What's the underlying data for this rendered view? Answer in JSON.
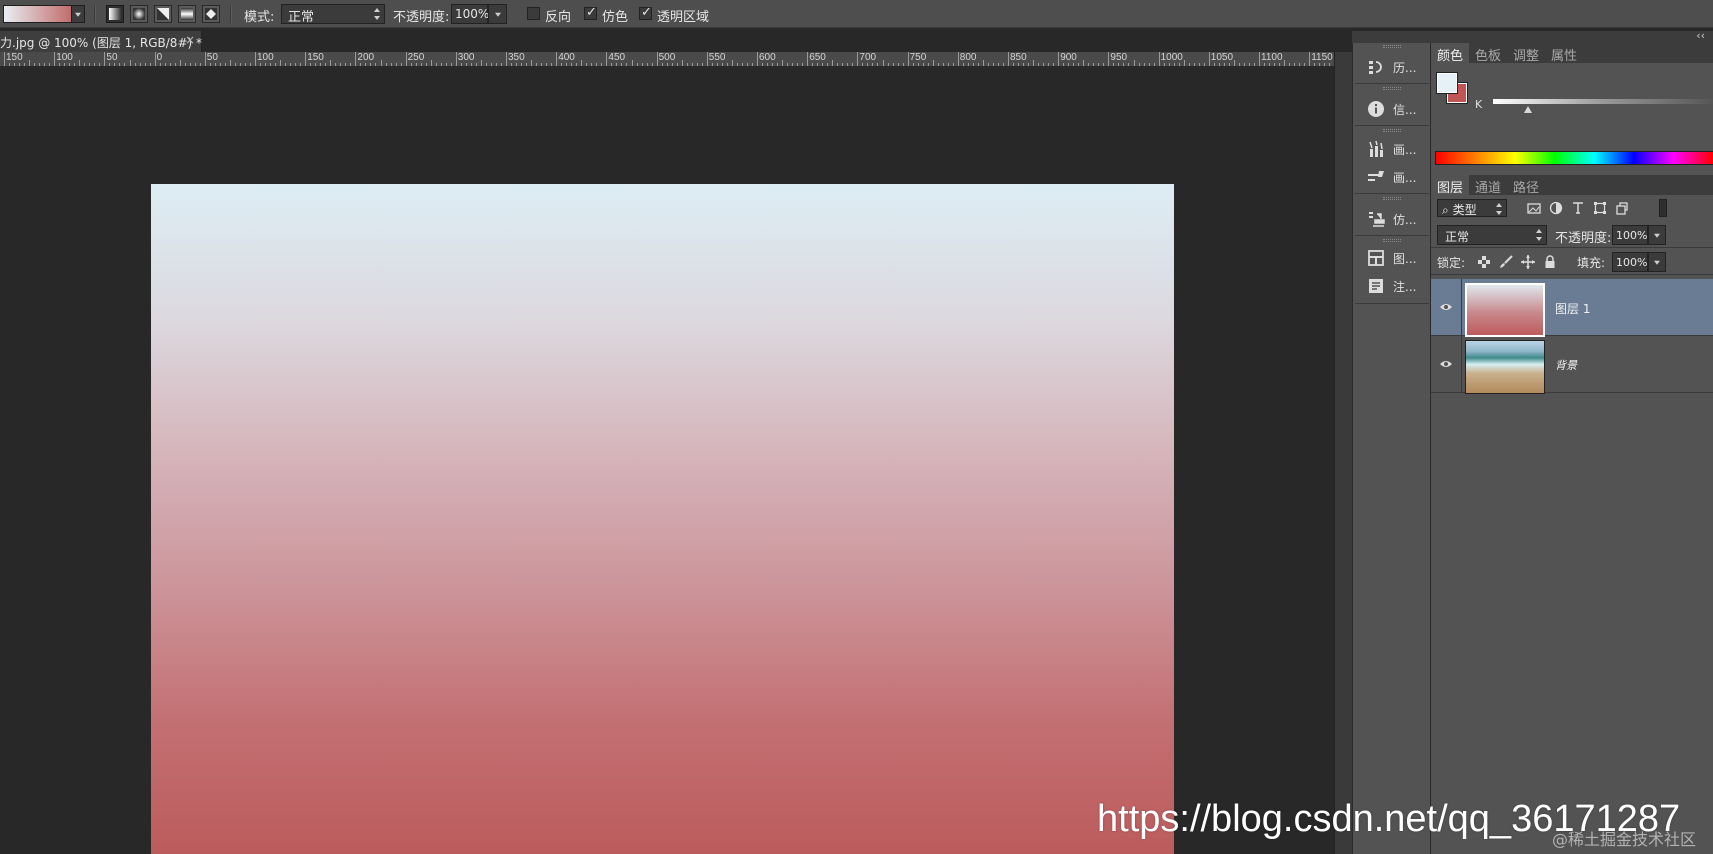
{
  "options_bar": {
    "mode_label": "模式:",
    "mode_value": "正常",
    "opacity_label": "不透明度:",
    "opacity_value": "100%",
    "reverse_label": "反向",
    "reverse_checked": false,
    "dither_label": "仿色",
    "dither_checked": true,
    "transparency_label": "透明区域",
    "transparency_checked": true,
    "gradient_types": [
      "linear-gradient-icon",
      "radial-gradient-icon",
      "angle-gradient-icon",
      "reflected-gradient-icon",
      "diamond-gradient-icon"
    ],
    "gradient_colors": [
      "#e8eef2",
      "#b95452"
    ]
  },
  "document": {
    "tab_title": "力.jpg @ 100% (图层 1, RGB/8#) *",
    "close_glyph": "×"
  },
  "ruler": {
    "labels": [
      "150",
      "100",
      "50",
      "0",
      "50",
      "100",
      "150",
      "200",
      "250",
      "300",
      "350",
      "400",
      "450",
      "500",
      "550",
      "600",
      "650",
      "700",
      "750",
      "800",
      "850",
      "900",
      "950",
      "1000",
      "1050",
      "1100",
      "1150"
    ]
  },
  "canvas": {
    "gradient_stops": [
      "#ddedf4",
      "#dcd9df",
      "#d5b5bb",
      "#cc959a",
      "#c37073",
      "#bc5b5c"
    ]
  },
  "dock": {
    "collapse_glyph": "‹‹",
    "items": [
      {
        "label": "历...",
        "icon": "history-icon"
      },
      {
        "label": "信...",
        "icon": "info-icon"
      },
      {
        "label": "画...",
        "icon": "brush-presets-icon"
      },
      {
        "label": "画...",
        "icon": "brush-icon"
      },
      {
        "label": "仿...",
        "icon": "clone-source-icon"
      },
      {
        "label": "图...",
        "icon": "layer-comps-icon"
      },
      {
        "label": "注...",
        "icon": "notes-icon"
      }
    ]
  },
  "color_panel": {
    "tabs": [
      "颜色",
      "色板",
      "调整",
      "属性"
    ],
    "active_tab": "颜色",
    "slider_label": "K",
    "foreground_color": "#e5f1f7",
    "background_color": "#c05553"
  },
  "layers_panel": {
    "tabs": [
      "图层",
      "通道",
      "路径"
    ],
    "active_tab": "图层",
    "filter_kind": "类型",
    "filter_icons": [
      "image-filter-icon",
      "adjustment-filter-icon",
      "type-filter-icon",
      "shape-filter-icon",
      "smart-object-filter-icon"
    ],
    "blend_mode": "正常",
    "opacity_label": "不透明度:",
    "opacity_value": "100%",
    "lock_label": "锁定:",
    "fill_label": "填充:",
    "fill_value": "100%",
    "layers": [
      {
        "name": "图层 1",
        "selected": true,
        "visible": true
      },
      {
        "name": "背景",
        "selected": false,
        "visible": true
      }
    ]
  },
  "watermark": {
    "url": "https://blog.csdn.net/qq_36171287",
    "sub": "@稀土掘金技术社区"
  }
}
